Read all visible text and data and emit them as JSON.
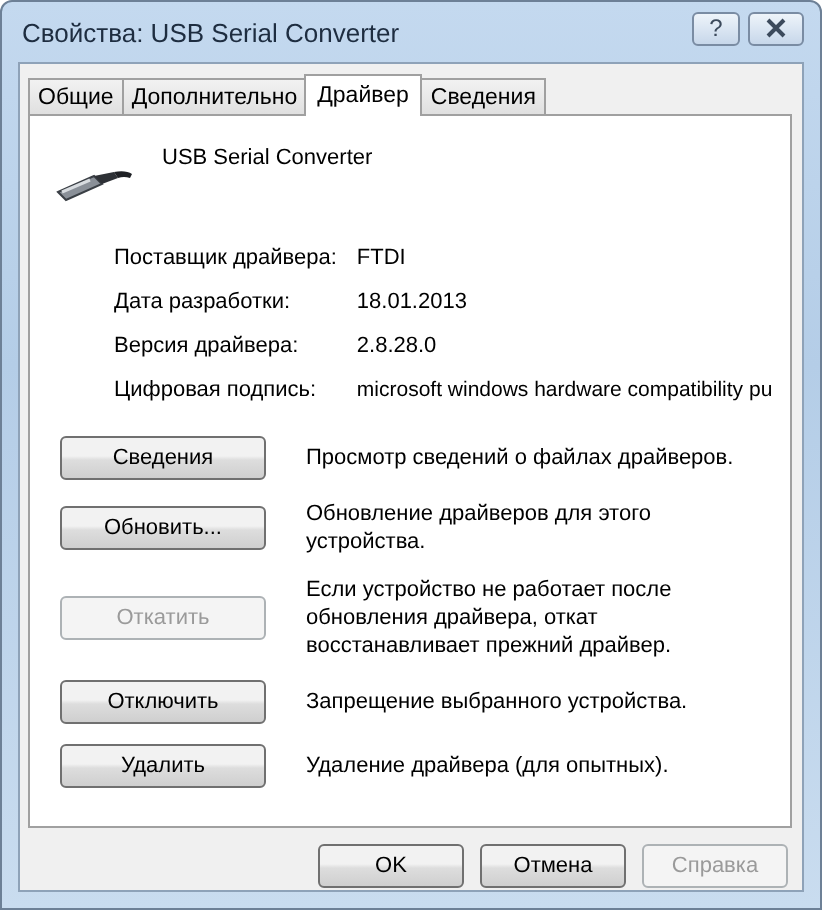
{
  "window": {
    "title": "Свойства: USB Serial Converter",
    "help": "?"
  },
  "tabs": [
    {
      "label": "Общие",
      "selected": false
    },
    {
      "label": "Дополнительно",
      "selected": false
    },
    {
      "label": "Драйвер",
      "selected": true
    },
    {
      "label": "Сведения",
      "selected": false
    }
  ],
  "device": {
    "name": "USB Serial Converter"
  },
  "properties": [
    {
      "label": "Поставщик драйвера:",
      "value": "FTDI"
    },
    {
      "label": "Дата разработки:",
      "value": "18.01.2013"
    },
    {
      "label": "Версия драйвера:",
      "value": "2.8.28.0"
    },
    {
      "label": "Цифровая подпись:",
      "value": "microsoft windows hardware compatibility pu"
    }
  ],
  "actions": [
    {
      "label": "Сведения",
      "description": "Просмотр сведений о файлах драйверов.",
      "disabled": false
    },
    {
      "label": "Обновить...",
      "description": "Обновление драйверов для этого устройства.",
      "disabled": false
    },
    {
      "label": "Откатить",
      "description": "Если устройство не работает после обновления драйвера, откат восстанавливает прежний драйвер.",
      "disabled": true
    },
    {
      "label": "Отключить",
      "description": "Запрещение выбранного устройства.",
      "disabled": false
    },
    {
      "label": "Удалить",
      "description": "Удаление драйвера (для опытных).",
      "disabled": false
    }
  ],
  "buttons": [
    {
      "label": "OK",
      "disabled": false
    },
    {
      "label": "Отмена",
      "disabled": false
    },
    {
      "label": "Справка",
      "disabled": true
    }
  ]
}
